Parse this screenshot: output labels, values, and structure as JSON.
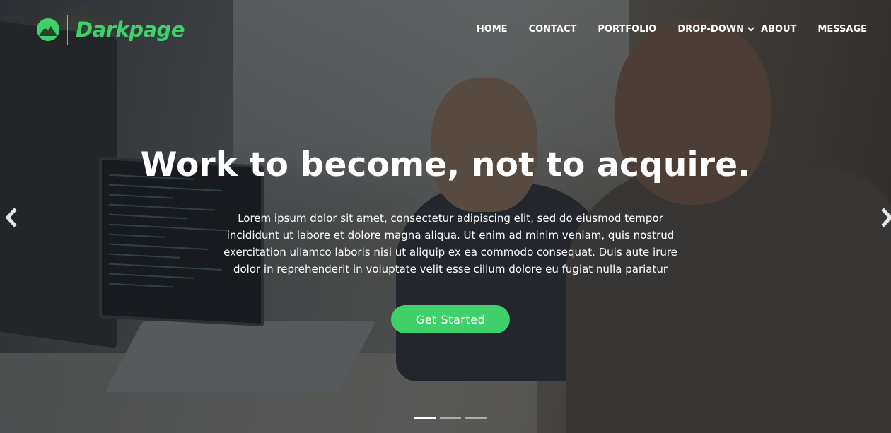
{
  "brand": {
    "name": "Darkpage",
    "logo_icon": "mountain-logo-icon",
    "accent_color": "#3fd06a"
  },
  "nav": {
    "items": [
      {
        "label": "HOME"
      },
      {
        "label": "CONTACT"
      },
      {
        "label": "PORTFOLIO"
      },
      {
        "label": "DROP-DOWN",
        "icon": "chevron-down-icon"
      },
      {
        "label": "ABOUT"
      },
      {
        "label": "MESSAGE"
      }
    ]
  },
  "hero": {
    "headline": "Work to become, not to acquire.",
    "description": "Lorem ipsum dolor sit amet, consectetur adipiscing elit, sed do eiusmod tempor incididunt ut labore et dolore magna aliqua. Ut enim ad minim veniam, quis nostrud exercitation ullamco laboris nisi ut aliquip ex ea commodo consequat. Duis aute irure dolor in reprehenderit in voluptate velit esse cillum dolore eu fugiat nulla pariatur",
    "cta_label": "Get Started",
    "prev_icon": "chevron-left-icon",
    "next_icon": "chevron-right-icon"
  },
  "carousel": {
    "slide_count": 3,
    "active_index": 0
  }
}
